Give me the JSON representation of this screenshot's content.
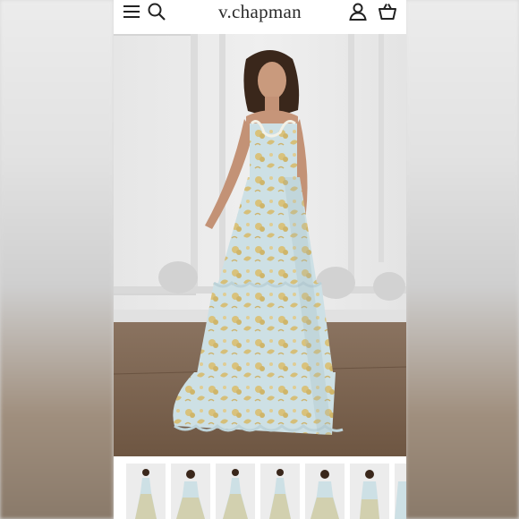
{
  "brand": {
    "name": "v.chapman"
  },
  "header": {
    "icons": [
      "menu-icon",
      "search-icon",
      "account-icon",
      "cart-icon"
    ]
  },
  "hero": {
    "icon": "product-photo-floral-tiered-gown"
  },
  "thumbnails": {
    "count": 7
  },
  "colors": {
    "gown_base": "#cfe1e6",
    "gown_pattern": "#d8c07a",
    "wall": "#ebebeb",
    "floor": "#7b6450",
    "text": "#2a2a2a"
  }
}
